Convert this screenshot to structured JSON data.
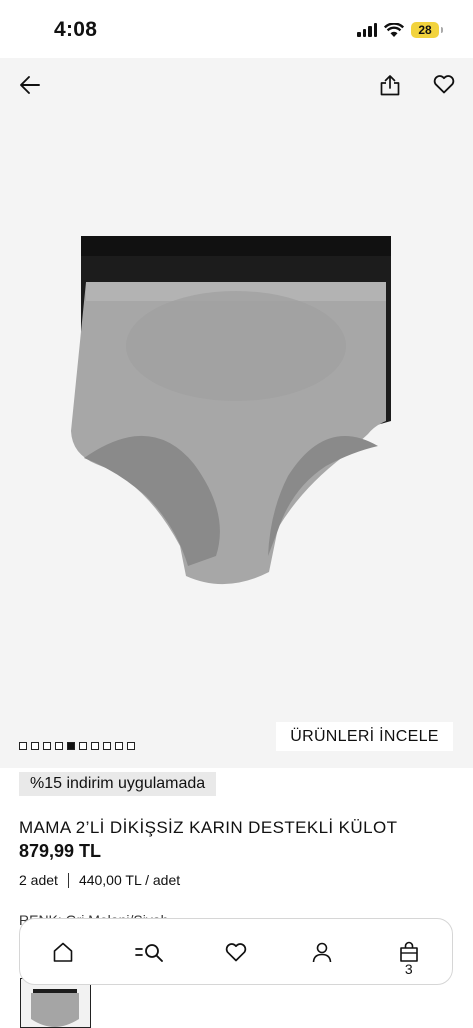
{
  "status_bar": {
    "time": "4:08",
    "battery": "28",
    "icons": [
      "cellular-signal-icon",
      "wifi-icon",
      "battery-icon"
    ]
  },
  "header": {
    "icons": [
      "back-arrow-icon",
      "share-icon",
      "heart-icon"
    ]
  },
  "gallery": {
    "image_count": 10,
    "active_index": 4,
    "explore_label": "ÜRÜNLERİ İNCELE"
  },
  "product": {
    "discount": "%15 indirim uygulamada",
    "title": "MAMA 2’Lİ DİKİŞSİZ KARIN DESTEKLİ KÜLOT",
    "price": "879,99 TL",
    "quantity": "2 adet",
    "unit_price": "440,00 TL / adet",
    "color_label": "RENK: Gri Melanj/Siyah"
  },
  "bottom_nav": {
    "items": [
      "home-icon",
      "search-icon",
      "heart-icon",
      "account-icon",
      "bag-icon"
    ],
    "bag_count": "3"
  },
  "colors": {
    "accent_yellow": "#f2d33d",
    "image_bg": "#f4f4f4",
    "badge_bg": "#e9e9e9"
  }
}
